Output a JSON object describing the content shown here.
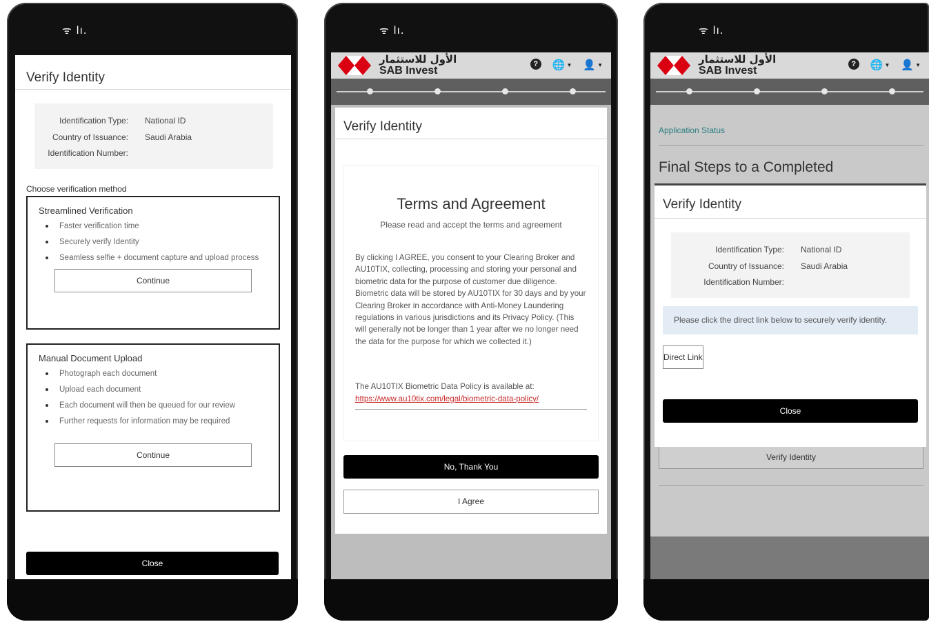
{
  "status_bar": {
    "signal": "ᯤ lı."
  },
  "screen1": {
    "modal_title": "Verify Identity",
    "info": [
      {
        "label": "Identification Type:",
        "value": "National ID"
      },
      {
        "label": "Country of Issuance:",
        "value": "Saudi Arabia"
      },
      {
        "label": "Identification Number:",
        "value": ""
      }
    ],
    "choose_label": "Choose verification method",
    "streamlined": {
      "title": "Streamlined Verification",
      "bullets": [
        "Faster verification time",
        "Securely verify Identity",
        "Seamless selfie + document capture and upload process"
      ],
      "button": "Continue"
    },
    "manual": {
      "title": "Manual Document Upload",
      "bullets": [
        "Photograph each document",
        "Upload each document",
        "Each document will then be queued for our review",
        "Further requests for information may be required"
      ],
      "button": "Continue"
    },
    "close_button": "Close"
  },
  "header": {
    "brand_arabic": "الأول للاستثمار",
    "brand_english": "SAB Invest",
    "help_icon": "?",
    "globe_icon": "🌐",
    "user_icon": "👤"
  },
  "screen2": {
    "modal_title": "Verify Identity",
    "terms_title": "Terms and Agreement",
    "terms_subtitle": "Please read and accept the terms and agreement",
    "terms_body": "By clicking I AGREE, you consent to your Clearing Broker and AU10TIX, collecting, processing and storing your personal and biometric data for the purpose of customer due diligence. Biometric data will be stored by AU10TIX for 30 days and by your Clearing Broker in accordance with Anti-Money Laundering regulations in various jurisdictions and its Privacy Policy. (This will generally not be longer than 1 year after we no longer need the data for the purpose for which we collected it.)",
    "policy_text": "The AU10TIX Biometric Data Policy is available at:",
    "policy_link": "https://www.au10tix.com/legal/biometric-data-policy/",
    "decline_button": "No, Thank You",
    "agree_button": "I Agree"
  },
  "screen3": {
    "app_status": "Application Status",
    "page_title": "Final Steps to a Completed",
    "modal_title": "Verify Identity",
    "info": [
      {
        "label": "Identification Type:",
        "value": "National ID"
      },
      {
        "label": "Country of Issuance:",
        "value": "Saudi Arabia"
      },
      {
        "label": "Identification Number:",
        "value": ""
      }
    ],
    "notice": "Please click the direct link below to securely verify identity.",
    "direct_link_button": "Direct Link",
    "close_button": "Close",
    "bg_verify_button": "Verify Identity"
  }
}
